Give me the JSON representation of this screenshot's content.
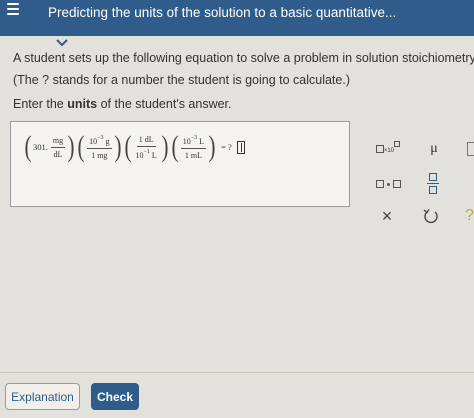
{
  "header": {
    "title": "Predicting the units of the solution to a basic quantitative...",
    "menu_icon": "hamburger-menu-icon",
    "collapse_icon": "chevron-down-icon",
    "bg_color": "#2f5c8a"
  },
  "prompt": {
    "line1": "A student sets up the following equation to solve a problem in solution stoichiometry.",
    "line2": "(The ? stands for a number the student is going to calculate.)",
    "line3_prefix": "Enter the",
    "line3_bold": "units",
    "line3_suffix": "of the student's answer."
  },
  "equation": {
    "term1": {
      "coef": "301.",
      "num": "mg",
      "den": "dL"
    },
    "term2": {
      "num_base": "10",
      "num_exp": "−3",
      "num_unit": "g",
      "den": "1 mg"
    },
    "term3": {
      "num": "1 dL",
      "den_base": "10",
      "den_exp": "−1",
      "den_unit": "L"
    },
    "term4": {
      "num_base": "10",
      "num_exp": "−3",
      "num_unit": "L",
      "den": "1 mL"
    },
    "equals": "= ?"
  },
  "palette": {
    "sci_exp": "×10",
    "mu": "μ",
    "times": "×",
    "help": "?",
    "icons": [
      "scientific-notation-icon",
      "mu-icon",
      "dot-multiply-icon",
      "fraction-icon",
      "clear-icon",
      "undo-icon",
      "help-icon"
    ]
  },
  "buttons": {
    "explanation": "Explanation",
    "check": "Check"
  }
}
